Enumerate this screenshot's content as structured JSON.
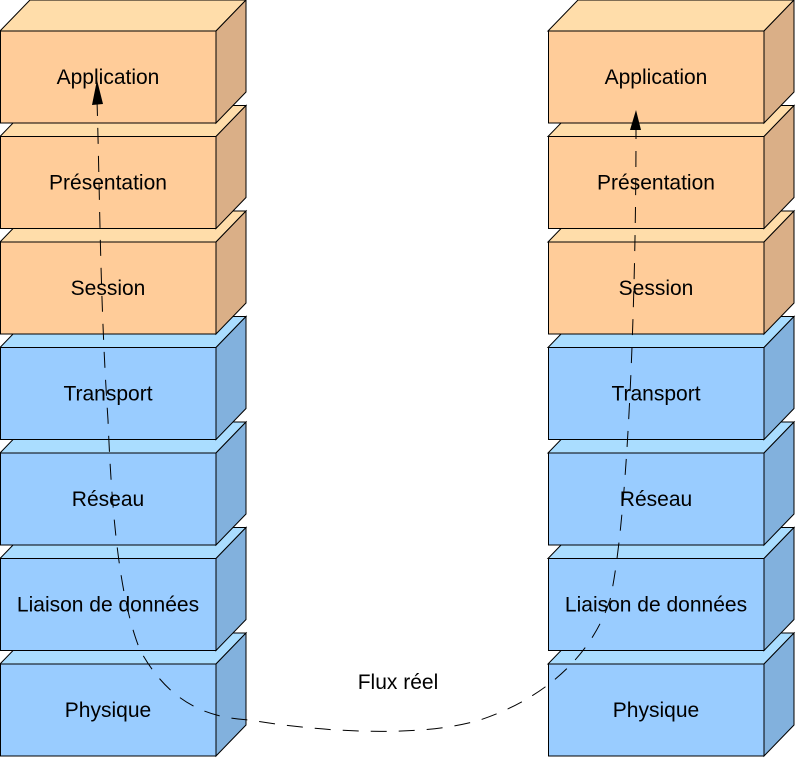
{
  "stacks": [
    {
      "name": "left",
      "layers": [
        "Application",
        "Présentation",
        "Session",
        "Transport",
        "Réseau",
        "Liaison de données",
        "Physique"
      ]
    },
    {
      "name": "right",
      "layers": [
        "Application",
        "Présentation",
        "Session",
        "Transport",
        "Réseau",
        "Liaison de données",
        "Physique"
      ]
    }
  ],
  "flow_label": "Flux réel",
  "colors": {
    "upper": {
      "front": "#FFCC99",
      "top": "#FFDDAA",
      "side": "#DAAF87"
    },
    "lower": {
      "front": "#99CCFF",
      "top": "#AADDFF",
      "side": "#82B1DD"
    },
    "stroke": "#000000"
  },
  "upper_layer_count": 3
}
